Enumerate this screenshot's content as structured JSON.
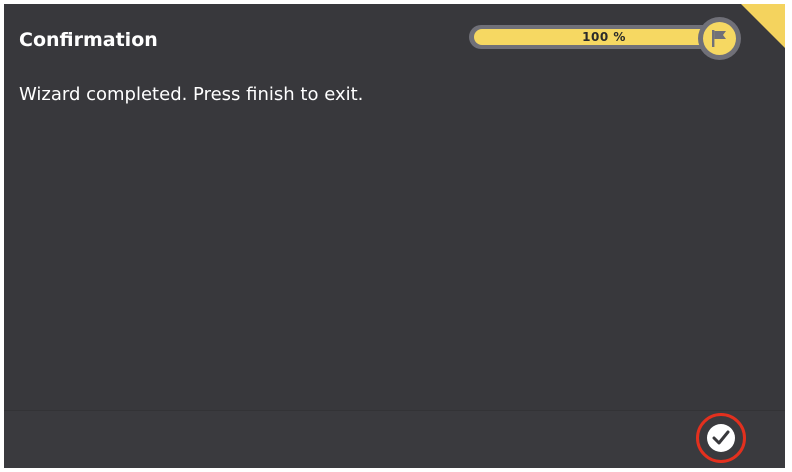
{
  "dialog": {
    "title": "Confirmation",
    "message": "Wizard completed. Press finish to exit."
  },
  "progress": {
    "label": "100 %",
    "fraction": 1.0,
    "icon": "flag-icon"
  },
  "footer": {
    "finish_icon": "checkmark-icon"
  },
  "colors": {
    "background": "#38383c",
    "accent": "#f6d862",
    "track": "#707078",
    "highlight_ring": "#e3301e",
    "text": "#ffffff"
  }
}
